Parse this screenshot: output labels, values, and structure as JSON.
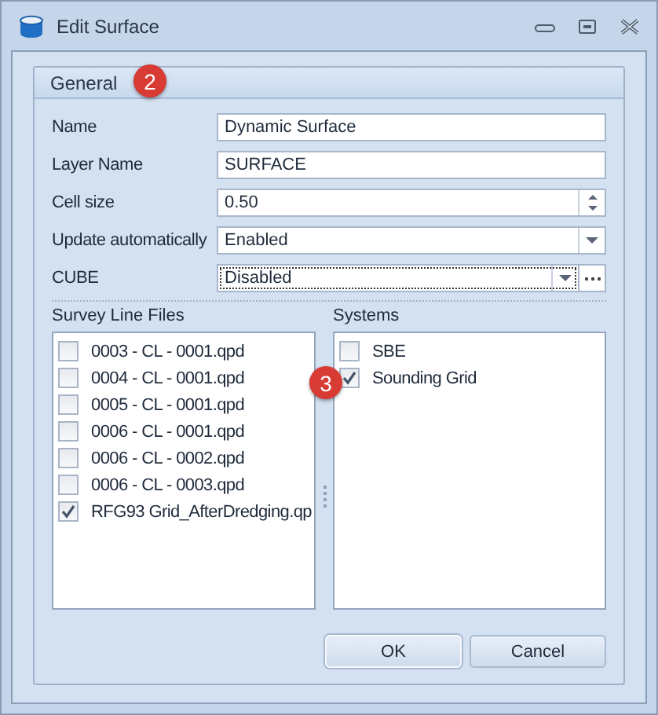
{
  "window": {
    "title": "Edit Surface"
  },
  "group": {
    "title": "General",
    "badge": "2"
  },
  "fields": [
    {
      "label": "Name",
      "kind": "text",
      "value": "Dynamic Surface",
      "focused": false
    },
    {
      "label": "Layer Name",
      "kind": "text",
      "value": "SURFACE",
      "focused": false
    },
    {
      "label": "Cell size",
      "kind": "spin",
      "value": "0.50",
      "focused": false
    },
    {
      "label": "Update automatically",
      "kind": "combo",
      "value": "Enabled",
      "focused": false
    },
    {
      "label": "CUBE",
      "kind": "combo_ellipsis",
      "value": "Disabled",
      "focused": true
    }
  ],
  "survey_line_files": {
    "title": "Survey Line Files",
    "items": [
      {
        "label": "0003 - CL - 0001.qpd",
        "checked": false
      },
      {
        "label": "0004 - CL - 0001.qpd",
        "checked": false
      },
      {
        "label": "0005 - CL - 0001.qpd",
        "checked": false
      },
      {
        "label": "0006 - CL - 0001.qpd",
        "checked": false
      },
      {
        "label": "0006 - CL - 0002.qpd",
        "checked": false
      },
      {
        "label": "0006 - CL - 0003.qpd",
        "checked": false
      },
      {
        "label": "RFG93 Grid_AfterDredging.qp",
        "checked": true
      }
    ]
  },
  "splitter": {
    "badge": "3"
  },
  "systems": {
    "title": "Systems",
    "items": [
      {
        "label": "SBE",
        "checked": false
      },
      {
        "label": "Sounding Grid",
        "checked": true
      }
    ]
  },
  "buttons": [
    {
      "label": "OK",
      "default": true
    },
    {
      "label": "Cancel",
      "default": false
    }
  ]
}
